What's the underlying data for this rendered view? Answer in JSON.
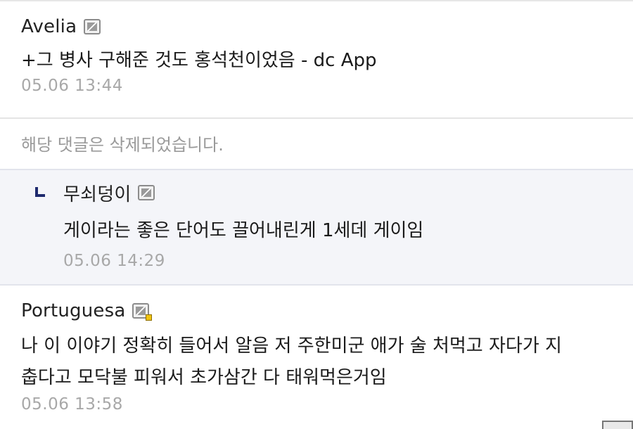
{
  "comments": [
    {
      "nick": "Avelia",
      "text": "+그 병사 구해준 것도 홍석천이었음 - dc App",
      "date": "05.06 13:44"
    },
    {
      "deleted_text": "해당 댓글은 삭제되었습니다."
    },
    {
      "nick": "무쇠덩이",
      "text": "게이라는 좋은 단어도 끌어내린게 1세데 게이임",
      "date": "05.06 14:29",
      "is_reply": true
    },
    {
      "nick": "Portuguesa",
      "text_lines": [
        "나 이 이야기 정확히 들어서 알음 저 주한미군 애가 술 처먹고 자다가 지",
        "춥다고 모닥불 피워서 초가삼간 다 태워먹은거임"
      ],
      "date": "05.06 13:58"
    }
  ],
  "icons": {
    "gallery_icon": "fixed-nick-icon",
    "gallery_icon_sub": "sub-manager-nick-icon",
    "reply_icon": "reply-arrow-icon"
  },
  "colors": {
    "reply_background": "#f4f5f9",
    "date_gray": "#a8a8a8",
    "reply_arrow": "#1e2a6e",
    "sub_badge": "#f1c40f"
  }
}
